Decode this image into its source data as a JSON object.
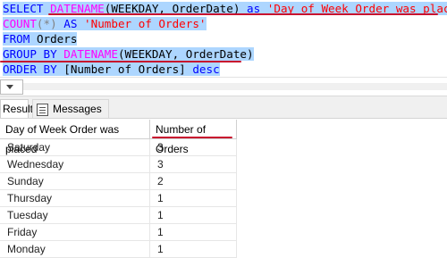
{
  "query": {
    "line1": {
      "kw": "SELECT",
      "fn": "DATENAME",
      "args": "(WEEKDAY, OrderDate)",
      "as": "as",
      "alias": "'Day of Week Order was placed'",
      "comma": ","
    },
    "line2": {
      "fn": "COUNT",
      "args": "(*)",
      "as": "AS",
      "alias": "'Number of Orders'"
    },
    "line3": {
      "kw": "FROM",
      "table": "Orders"
    },
    "line4": {
      "kw": "GROUP BY",
      "fn": "DATENAME",
      "args": "(WEEKDAY, OrderDate)"
    },
    "line5": {
      "kw": "ORDER BY",
      "col": "[Number of Orders]",
      "dir": "desc"
    }
  },
  "tabs": {
    "results": "Results",
    "messages": "Messages"
  },
  "grid": {
    "columns": [
      "Day of Week Order was placed",
      "Number of Orders"
    ],
    "rows": [
      [
        "Saturday",
        "3"
      ],
      [
        "Wednesday",
        "3"
      ],
      [
        "Sunday",
        "2"
      ],
      [
        "Thursday",
        "1"
      ],
      [
        "Tuesday",
        "1"
      ],
      [
        "Friday",
        "1"
      ],
      [
        "Monday",
        "1"
      ]
    ]
  },
  "colors": {
    "selection": "#add6ff",
    "keyword": "#0000ff",
    "function": "#ff00ff",
    "string": "#ff0000",
    "underline": "#c8102e"
  }
}
